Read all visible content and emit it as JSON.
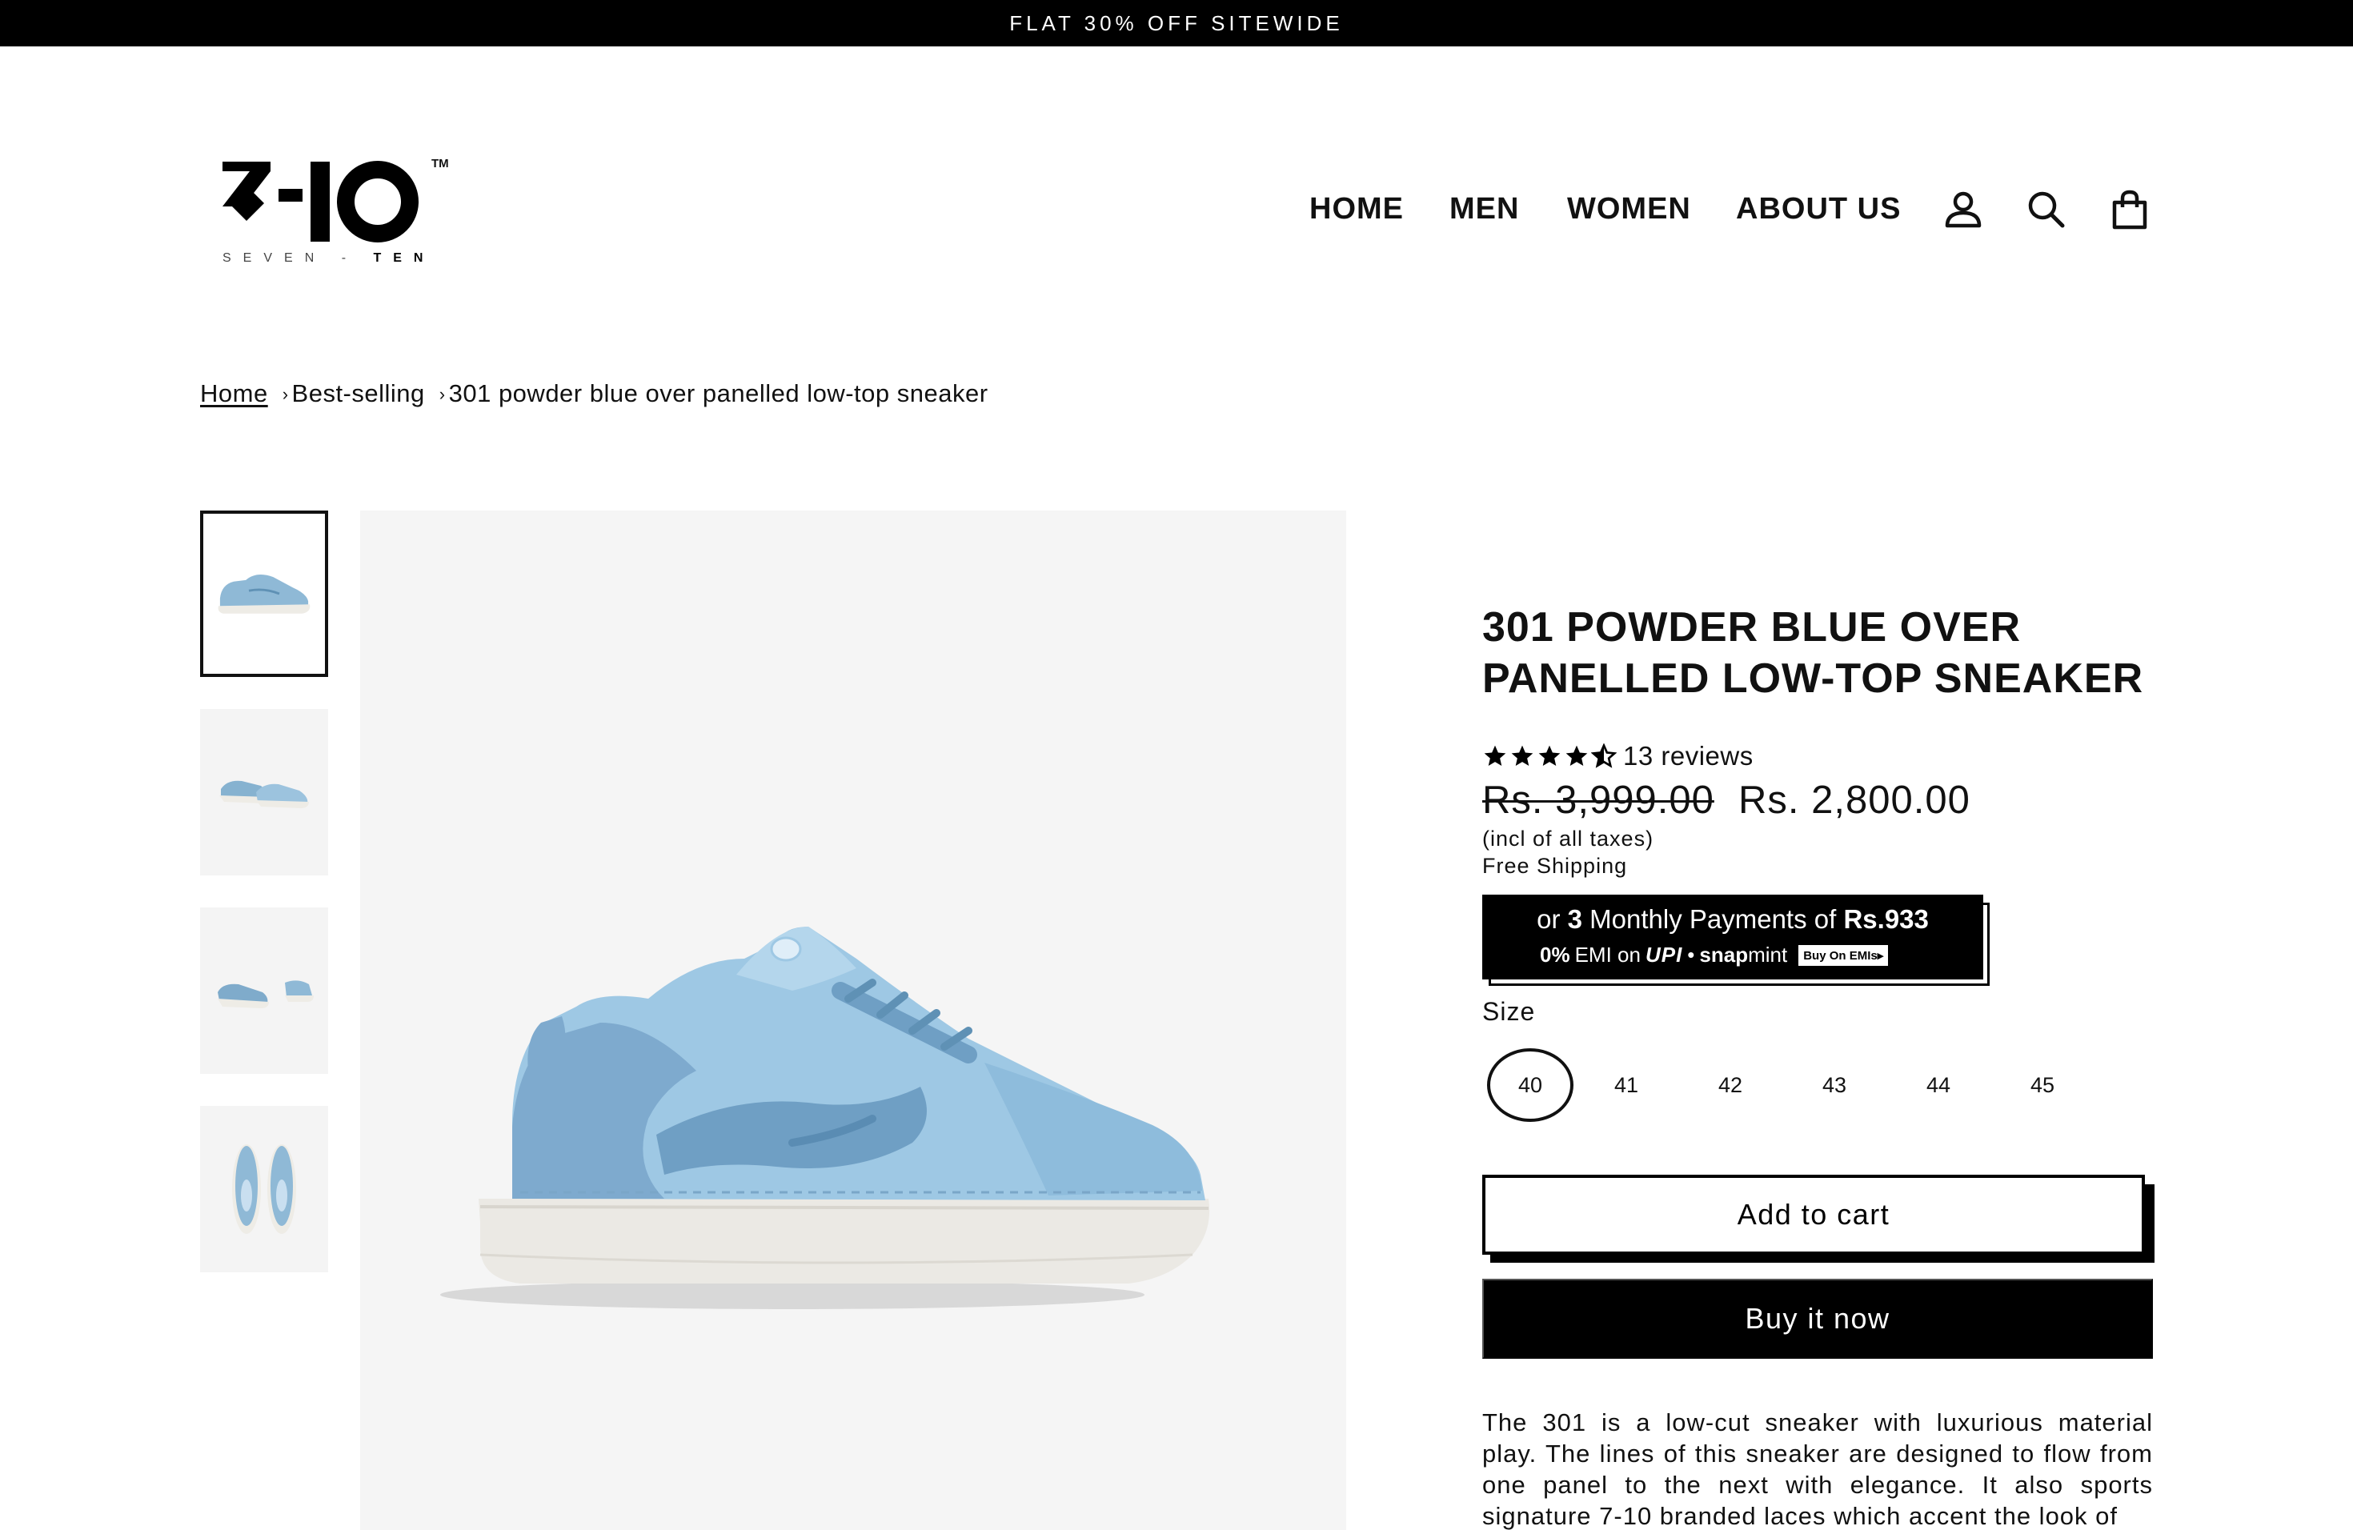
{
  "announcement": "FLAT 30% OFF SITEWIDE",
  "logo": {
    "tm": "TM",
    "wordmark_light": "SEVEN",
    "wordmark_dash": "-",
    "wordmark_bold": "TEN"
  },
  "nav": {
    "items": [
      "HOME",
      "MEN",
      "WOMEN",
      "ABOUT US"
    ],
    "icons": [
      "account-icon",
      "search-icon",
      "cart-icon"
    ]
  },
  "breadcrumb": {
    "home": "Home",
    "separator": "›",
    "category": "Best-selling",
    "current": "301 powder blue over panelled low-top sneaker"
  },
  "gallery": {
    "thumbnail_count": 4,
    "active_index": 0
  },
  "product": {
    "title": "301 POWDER BLUE OVER PANELLED LOW-TOP SNEAKER",
    "rating": 4.5,
    "reviews": "13 reviews",
    "compare_price": "Rs. 3,999.00",
    "price": "Rs. 2,800.00",
    "tax_note": "(incl of all taxes)",
    "shipping_note": "Free Shipping"
  },
  "emi": {
    "line1_prefix": "or ",
    "line1_count": "3",
    "line1_mid": " Monthly Payments of ",
    "line1_amount": "Rs.933",
    "line2_pct": "0%",
    "line2_text": " EMI on ",
    "upi": "UPI",
    "dot": "•",
    "snap_bold": "snap",
    "snap_light": "mint",
    "badge": "Buy On EMIs▸"
  },
  "size": {
    "label": "Size",
    "options": [
      "40",
      "41",
      "42",
      "43",
      "44",
      "45"
    ],
    "selected": "40"
  },
  "buttons": {
    "add_to_cart": "Add to cart",
    "buy_now": "Buy it now"
  },
  "description": "The 301 is a low-cut sneaker with luxurious material play. The lines of this sneaker are designed to flow from one panel to the next with elegance. It also sports signature 7-10 branded laces which accent the look of"
}
